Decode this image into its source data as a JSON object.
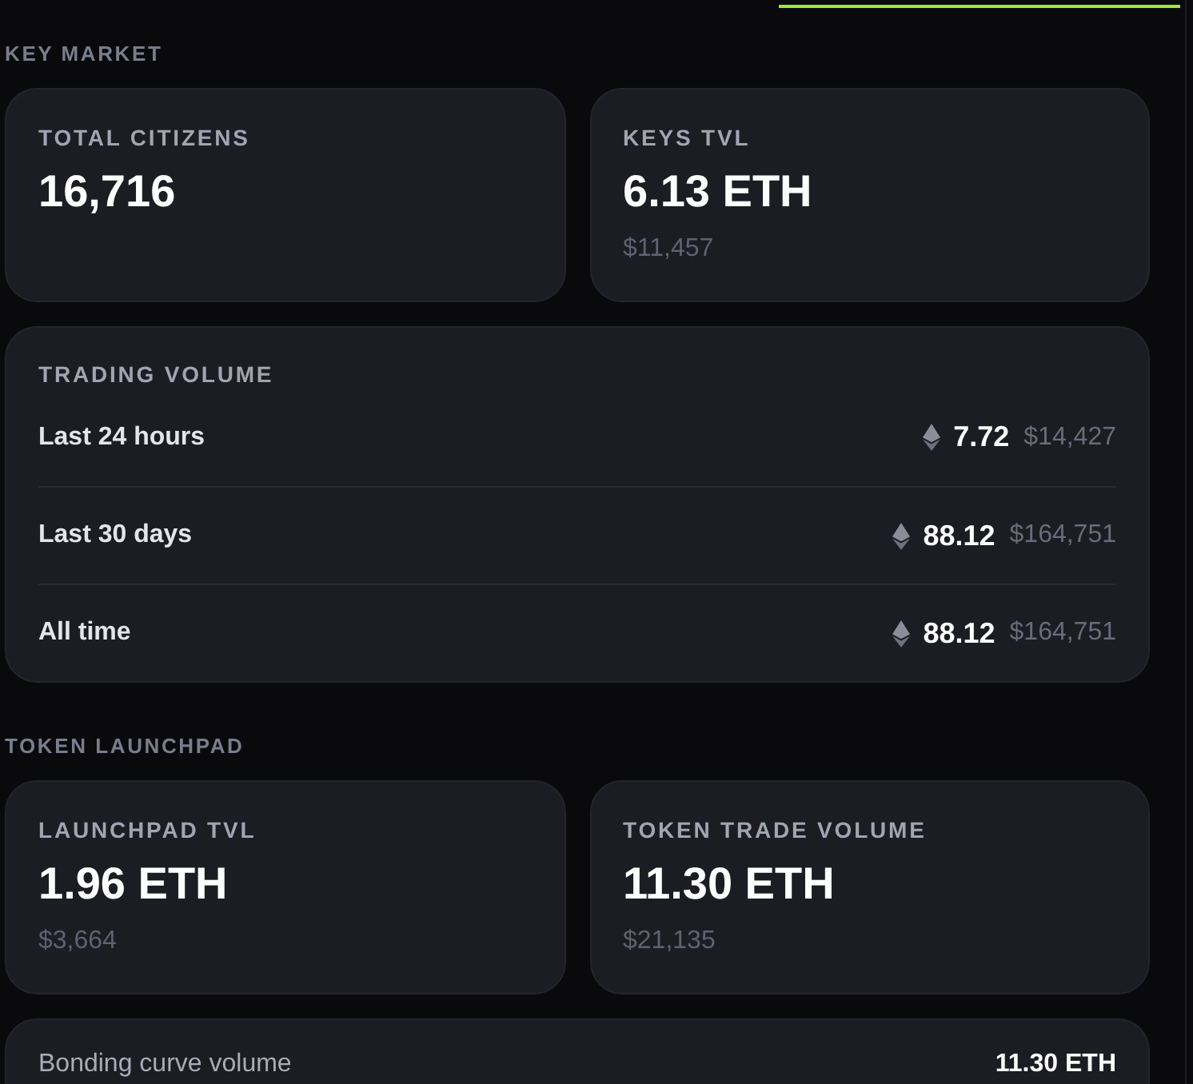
{
  "sections": [
    {
      "title": "KEY MARKET",
      "stats": [
        {
          "label": "TOTAL CITIZENS",
          "value": "16,716"
        },
        {
          "label": "KEYS TVL",
          "value": "6.13 ETH",
          "usd": "$11,457"
        }
      ],
      "breakdown": {
        "title": "TRADING VOLUME",
        "rows": [
          {
            "kind": "eth",
            "label": "Last 24 hours",
            "amount": "7.72",
            "usd": "$14,427"
          },
          {
            "kind": "eth",
            "label": "Last 30 days",
            "amount": "88.12",
            "usd": "$164,751"
          },
          {
            "kind": "eth",
            "label": "All time",
            "amount": "88.12",
            "usd": "$164,751"
          }
        ]
      }
    },
    {
      "title": "TOKEN LAUNCHPAD",
      "stats": [
        {
          "label": "LAUNCHPAD TVL",
          "value": "1.96 ETH",
          "usd": "$3,664"
        },
        {
          "label": "TOKEN TRADE VOLUME",
          "value": "11.30 ETH",
          "usd": "$21,135"
        }
      ],
      "breakdown": {
        "rows": [
          {
            "kind": "plain",
            "label": "Bonding curve volume",
            "amount": "11.30 ETH"
          }
        ]
      }
    }
  ]
}
